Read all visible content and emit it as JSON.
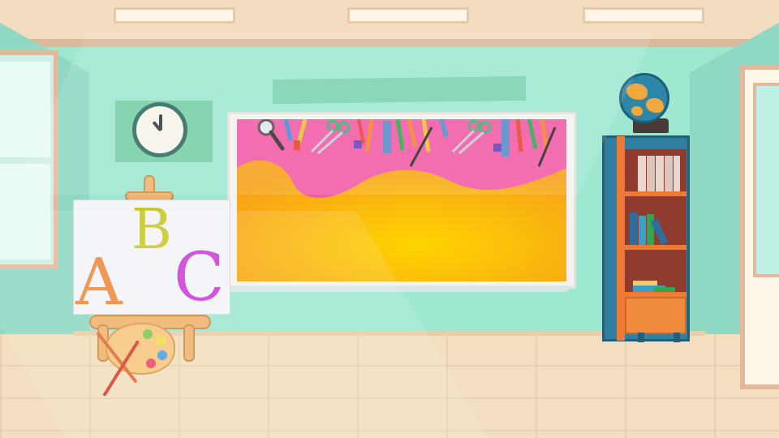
{
  "scene": {
    "easel_letters": [
      "A",
      "B",
      "C"
    ],
    "icons": [
      "wall-clock-icon",
      "globe-icon",
      "palette-icon",
      "paintbrush-icon",
      "scissors-icon",
      "magnifier-icon",
      "pencil-icon",
      "book-icon"
    ]
  },
  "colors": {
    "wall": "#9ee7d1",
    "board_pink": "#f25aa6",
    "board_yellow": "#f9b817",
    "letter_a": "#ee8a3d",
    "letter_b": "#c7c82a",
    "letter_c": "#cc3fd8",
    "shelf_blue": "#2f7fa1",
    "shelf_orange": "#ee7a36"
  }
}
